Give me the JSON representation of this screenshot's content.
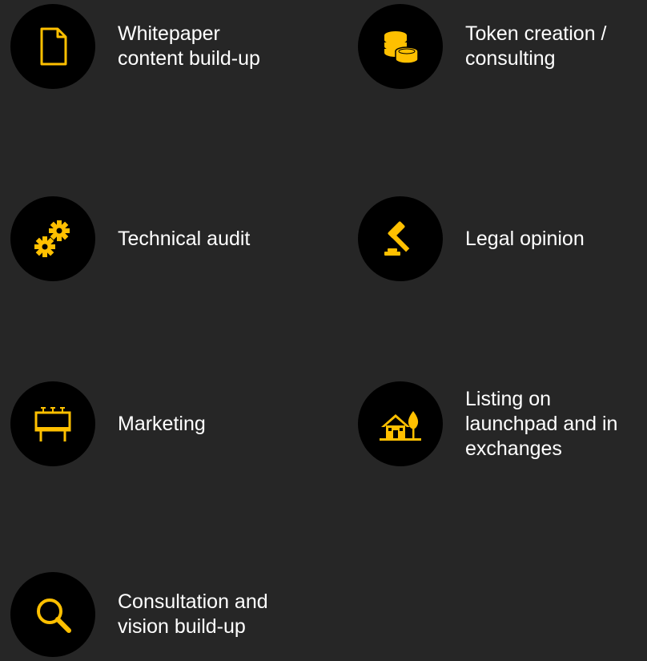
{
  "colors": {
    "background": "#262626",
    "icon_circle": "#000000",
    "accent": "#FFC000",
    "text": "#FFFFFF"
  },
  "services": [
    {
      "icon": "document-icon",
      "lines": [
        "Whitepaper",
        "content build-up"
      ]
    },
    {
      "icon": "coins-icon",
      "lines": [
        "Token creation /",
        "consulting"
      ]
    },
    {
      "icon": "gears-icon",
      "lines": [
        "Technical audit"
      ]
    },
    {
      "icon": "gavel-icon",
      "lines": [
        "Legal opinion"
      ]
    },
    {
      "icon": "billboard-icon",
      "lines": [
        "Marketing"
      ]
    },
    {
      "icon": "house-icon",
      "lines": [
        "Listing on",
        "launchpad and in",
        "exchanges"
      ]
    },
    {
      "icon": "magnifier-icon",
      "lines": [
        "Consultation and",
        "vision build-up"
      ]
    }
  ]
}
